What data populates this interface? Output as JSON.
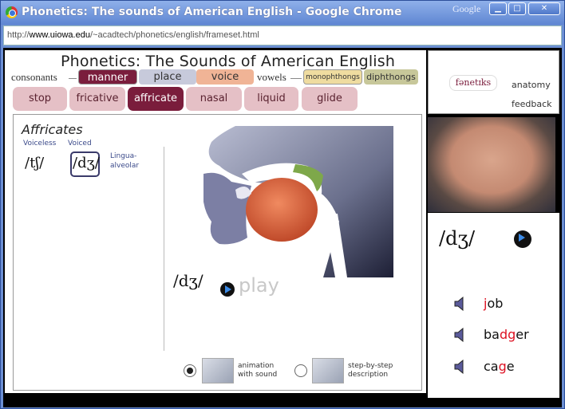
{
  "window": {
    "title": "Phonetics: The sounds of American English - Google Chrome",
    "brand": "Google",
    "min": "▁",
    "max": "□",
    "close": "✕"
  },
  "address": {
    "prefix": "http://",
    "host": "www.uiowa.edu",
    "path": "/~acadtech/phonetics/english/frameset.html"
  },
  "page": {
    "title": "Phonetics:  The Sounds of American English",
    "consonants_label": "consonants",
    "vowels_label": "vowels",
    "categories": [
      {
        "label": "manner",
        "color": "#7a1d3c",
        "text": "#ffffff"
      },
      {
        "label": "place",
        "color": "#c7cadb",
        "text": "#333333"
      },
      {
        "label": "voice",
        "color": "#f0b496",
        "text": "#333333"
      }
    ],
    "vowel_buttons": [
      {
        "label": "monophthongs",
        "color": "#efdca0"
      },
      {
        "label": "diphthongs",
        "color": "#c7c79a"
      }
    ],
    "tabs": [
      {
        "label": "stop"
      },
      {
        "label": "fricative"
      },
      {
        "label": "affricate",
        "active": true
      },
      {
        "label": "nasal"
      },
      {
        "label": "liquid"
      },
      {
        "label": "glide"
      }
    ],
    "panel": {
      "heading": "Affricates",
      "voiceless": "Voiceless",
      "voiced": "Voiced",
      "ipa_voiceless": "/tʃ/",
      "ipa_voiced": "/dʒ/",
      "place_line1": "Lingua-",
      "place_line2": "alveolar",
      "ipa_current": "/dʒ/",
      "play": "play",
      "option1_line1": "animation",
      "option1_line2": "with sound",
      "option2_line1": "step-by-step",
      "option2_line2": "description"
    }
  },
  "side": {
    "logo": "fənetɪks",
    "anatomy": "anatomy",
    "feedback": "feedback",
    "ipa": "/dʒ/",
    "words": [
      {
        "pre": "",
        "hl": "j",
        "post": "ob"
      },
      {
        "pre": "ba",
        "hl": "dg",
        "post": "er"
      },
      {
        "pre": "ca",
        "hl": "g",
        "post": "e"
      }
    ]
  }
}
